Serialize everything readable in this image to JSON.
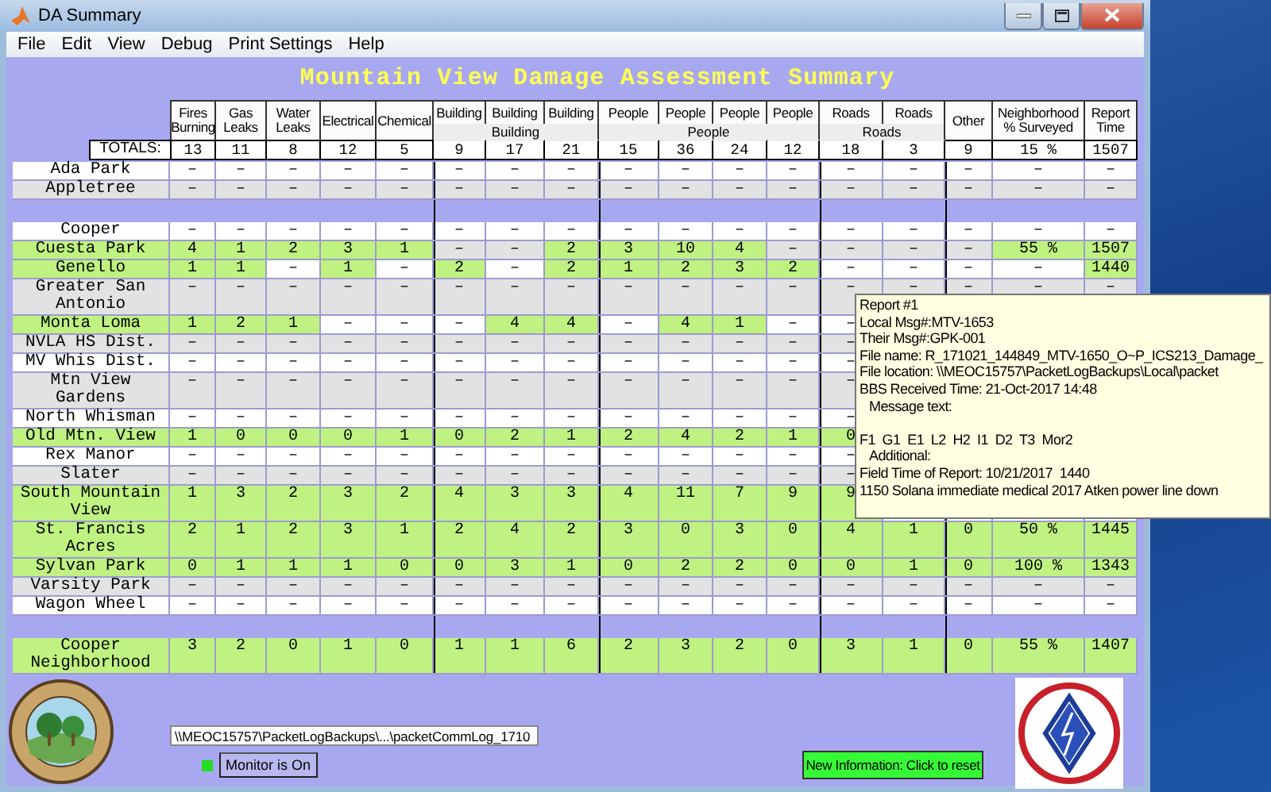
{
  "window": {
    "title": "DA Summary"
  },
  "menu": [
    "File",
    "Edit",
    "View",
    "Debug",
    "Print Settings",
    "Help"
  ],
  "heading": "Mountain View Damage Assessment Summary",
  "table": {
    "columns": [
      {
        "label": "Fires Burning"
      },
      {
        "label": "Gas Leaks"
      },
      {
        "label": "Water Leaks"
      },
      {
        "label": "Electrical"
      },
      {
        "label": "Chemical"
      },
      {
        "group": "Building",
        "columns": [
          {
            "label": "Building"
          },
          {
            "label": "Building"
          },
          {
            "label": "Building"
          }
        ]
      },
      {
        "group": "People",
        "columns": [
          {
            "label": "People"
          },
          {
            "label": "People"
          },
          {
            "label": "People"
          },
          {
            "label": "People"
          }
        ]
      },
      {
        "group": "Roads",
        "columns": [
          {
            "label": "Roads"
          },
          {
            "label": "Roads"
          }
        ]
      },
      {
        "label": "Other"
      },
      {
        "label": "Neighborhood % Surveyed"
      },
      {
        "label": "Report Time"
      }
    ],
    "totals": {
      "label": "TOTALS:",
      "values": [
        "13",
        "11",
        "8",
        "12",
        "5",
        "9",
        "17",
        "21",
        "15",
        "36",
        "24",
        "12",
        "18",
        "3",
        "9",
        "15 %",
        "1507"
      ]
    },
    "rows": [
      {
        "kind": "data",
        "name": "Ada Park",
        "highlighted": false,
        "cells": [
          {
            "text": "–",
            "highlighted": false
          },
          {
            "text": "–",
            "highlighted": false
          },
          {
            "text": "–",
            "highlighted": false
          },
          {
            "text": "–",
            "highlighted": false
          },
          {
            "text": "–",
            "highlighted": false
          },
          {
            "text": "–",
            "highlighted": false
          },
          {
            "text": "–",
            "highlighted": false
          },
          {
            "text": "–",
            "highlighted": false
          },
          {
            "text": "–",
            "highlighted": false
          },
          {
            "text": "–",
            "highlighted": false
          },
          {
            "text": "–",
            "highlighted": false
          },
          {
            "text": "–",
            "highlighted": false
          },
          {
            "text": "–",
            "highlighted": false
          },
          {
            "text": "–",
            "highlighted": false
          },
          {
            "text": "–",
            "highlighted": false
          },
          {
            "text": "–",
            "highlighted": false
          },
          {
            "text": "–",
            "highlighted": false
          }
        ]
      },
      {
        "kind": "data",
        "name": "Appletree",
        "highlighted": false,
        "cells": [
          {
            "text": "–",
            "highlighted": false
          },
          {
            "text": "–",
            "highlighted": false
          },
          {
            "text": "–",
            "highlighted": false
          },
          {
            "text": "–",
            "highlighted": false
          },
          {
            "text": "–",
            "highlighted": false
          },
          {
            "text": "–",
            "highlighted": false
          },
          {
            "text": "–",
            "highlighted": false
          },
          {
            "text": "–",
            "highlighted": false
          },
          {
            "text": "–",
            "highlighted": false
          },
          {
            "text": "–",
            "highlighted": false
          },
          {
            "text": "–",
            "highlighted": false
          },
          {
            "text": "–",
            "highlighted": false
          },
          {
            "text": "–",
            "highlighted": false
          },
          {
            "text": "–",
            "highlighted": false
          },
          {
            "text": "–",
            "highlighted": false
          },
          {
            "text": "–",
            "highlighted": false
          },
          {
            "text": "–",
            "highlighted": false
          }
        ]
      },
      {
        "kind": "separator"
      },
      {
        "kind": "data",
        "name": "Cooper",
        "highlighted": false,
        "cells": [
          {
            "text": "–",
            "highlighted": false
          },
          {
            "text": "–",
            "highlighted": false
          },
          {
            "text": "–",
            "highlighted": false
          },
          {
            "text": "–",
            "highlighted": false
          },
          {
            "text": "–",
            "highlighted": false
          },
          {
            "text": "–",
            "highlighted": false
          },
          {
            "text": "–",
            "highlighted": false
          },
          {
            "text": "–",
            "highlighted": false
          },
          {
            "text": "–",
            "highlighted": false
          },
          {
            "text": "–",
            "highlighted": false
          },
          {
            "text": "–",
            "highlighted": false
          },
          {
            "text": "–",
            "highlighted": false
          },
          {
            "text": "–",
            "highlighted": false
          },
          {
            "text": "–",
            "highlighted": false
          },
          {
            "text": "–",
            "highlighted": false
          },
          {
            "text": "–",
            "highlighted": false
          },
          {
            "text": "–",
            "highlighted": false
          }
        ]
      },
      {
        "kind": "data",
        "name": "Cuesta Park",
        "highlighted": true,
        "cells": [
          {
            "text": "4",
            "highlighted": true
          },
          {
            "text": "1",
            "highlighted": true
          },
          {
            "text": "2",
            "highlighted": true
          },
          {
            "text": "3",
            "highlighted": true
          },
          {
            "text": "1",
            "highlighted": true
          },
          {
            "text": "–",
            "highlighted": false
          },
          {
            "text": "–",
            "highlighted": false
          },
          {
            "text": "2",
            "highlighted": true
          },
          {
            "text": "3",
            "highlighted": true
          },
          {
            "text": "10",
            "highlighted": true
          },
          {
            "text": "4",
            "highlighted": true
          },
          {
            "text": "–",
            "highlighted": false
          },
          {
            "text": "–",
            "highlighted": false
          },
          {
            "text": "–",
            "highlighted": false
          },
          {
            "text": "–",
            "highlighted": false
          },
          {
            "text": "55 %",
            "highlighted": true
          },
          {
            "text": "1507",
            "highlighted": true
          }
        ]
      },
      {
        "kind": "data",
        "name": "Genello",
        "highlighted": true,
        "cells": [
          {
            "text": "1",
            "highlighted": true
          },
          {
            "text": "1",
            "highlighted": true
          },
          {
            "text": "–",
            "highlighted": false
          },
          {
            "text": "1",
            "highlighted": true
          },
          {
            "text": "–",
            "highlighted": false
          },
          {
            "text": "2",
            "highlighted": true
          },
          {
            "text": "–",
            "highlighted": false
          },
          {
            "text": "2",
            "highlighted": true
          },
          {
            "text": "1",
            "highlighted": true
          },
          {
            "text": "2",
            "highlighted": true
          },
          {
            "text": "3",
            "highlighted": true
          },
          {
            "text": "2",
            "highlighted": true
          },
          {
            "text": "–",
            "highlighted": false
          },
          {
            "text": "–",
            "highlighted": false
          },
          {
            "text": "–",
            "highlighted": false
          },
          {
            "text": "–",
            "highlighted": false
          },
          {
            "text": "1440",
            "highlighted": true
          }
        ]
      },
      {
        "kind": "data",
        "name": "Greater San Antonio",
        "highlighted": false,
        "cells": [
          {
            "text": "–",
            "highlighted": false
          },
          {
            "text": "–",
            "highlighted": false
          },
          {
            "text": "–",
            "highlighted": false
          },
          {
            "text": "–",
            "highlighted": false
          },
          {
            "text": "–",
            "highlighted": false
          },
          {
            "text": "–",
            "highlighted": false
          },
          {
            "text": "–",
            "highlighted": false
          },
          {
            "text": "–",
            "highlighted": false
          },
          {
            "text": "–",
            "highlighted": false
          },
          {
            "text": "–",
            "highlighted": false
          },
          {
            "text": "–",
            "highlighted": false
          },
          {
            "text": "–",
            "highlighted": false
          },
          {
            "text": "–",
            "highlighted": false
          },
          {
            "text": "–",
            "highlighted": false
          },
          {
            "text": "–",
            "highlighted": false
          },
          {
            "text": "–",
            "highlighted": false
          },
          {
            "text": "–",
            "highlighted": false
          }
        ]
      },
      {
        "kind": "data",
        "name": "Monta Loma",
        "highlighted": true,
        "cells": [
          {
            "text": "1",
            "highlighted": true
          },
          {
            "text": "2",
            "highlighted": true
          },
          {
            "text": "1",
            "highlighted": true
          },
          {
            "text": "–",
            "highlighted": false
          },
          {
            "text": "–",
            "highlighted": false
          },
          {
            "text": "–",
            "highlighted": false
          },
          {
            "text": "4",
            "highlighted": true
          },
          {
            "text": "4",
            "highlighted": true
          },
          {
            "text": "–",
            "highlighted": false
          },
          {
            "text": "4",
            "highlighted": true
          },
          {
            "text": "1",
            "highlighted": true
          },
          {
            "text": "–",
            "highlighted": false
          },
          {
            "text": "–",
            "highlighted": false
          }
        ]
      },
      {
        "kind": "data",
        "name": "NVLA HS Dist.",
        "highlighted": false,
        "cells": [
          {
            "text": "–",
            "highlighted": false
          },
          {
            "text": "–",
            "highlighted": false
          },
          {
            "text": "–",
            "highlighted": false
          },
          {
            "text": "–",
            "highlighted": false
          },
          {
            "text": "–",
            "highlighted": false
          },
          {
            "text": "–",
            "highlighted": false
          },
          {
            "text": "–",
            "highlighted": false
          },
          {
            "text": "–",
            "highlighted": false
          },
          {
            "text": "–",
            "highlighted": false
          },
          {
            "text": "–",
            "highlighted": false
          },
          {
            "text": "–",
            "highlighted": false
          },
          {
            "text": "–",
            "highlighted": false
          },
          {
            "text": "–",
            "highlighted": false
          }
        ]
      },
      {
        "kind": "data",
        "name": "MV Whis Dist.",
        "highlighted": false,
        "cells": [
          {
            "text": "–",
            "highlighted": false
          },
          {
            "text": "–",
            "highlighted": false
          },
          {
            "text": "–",
            "highlighted": false
          },
          {
            "text": "–",
            "highlighted": false
          },
          {
            "text": "–",
            "highlighted": false
          },
          {
            "text": "–",
            "highlighted": false
          },
          {
            "text": "–",
            "highlighted": false
          },
          {
            "text": "–",
            "highlighted": false
          },
          {
            "text": "–",
            "highlighted": false
          },
          {
            "text": "–",
            "highlighted": false
          },
          {
            "text": "–",
            "highlighted": false
          },
          {
            "text": "–",
            "highlighted": false
          },
          {
            "text": "–",
            "highlighted": false
          }
        ]
      },
      {
        "kind": "data",
        "name": "Mtn View Gardens",
        "highlighted": false,
        "cells": [
          {
            "text": "–",
            "highlighted": false
          },
          {
            "text": "–",
            "highlighted": false
          },
          {
            "text": "–",
            "highlighted": false
          },
          {
            "text": "–",
            "highlighted": false
          },
          {
            "text": "–",
            "highlighted": false
          },
          {
            "text": "–",
            "highlighted": false
          },
          {
            "text": "–",
            "highlighted": false
          },
          {
            "text": "–",
            "highlighted": false
          },
          {
            "text": "–",
            "highlighted": false
          },
          {
            "text": "–",
            "highlighted": false
          },
          {
            "text": "–",
            "highlighted": false
          },
          {
            "text": "–",
            "highlighted": false
          },
          {
            "text": "–",
            "highlighted": false
          }
        ]
      },
      {
        "kind": "data",
        "name": "North Whisman",
        "highlighted": false,
        "cells": [
          {
            "text": "–",
            "highlighted": false
          },
          {
            "text": "–",
            "highlighted": false
          },
          {
            "text": "–",
            "highlighted": false
          },
          {
            "text": "–",
            "highlighted": false
          },
          {
            "text": "–",
            "highlighted": false
          },
          {
            "text": "–",
            "highlighted": false
          },
          {
            "text": "–",
            "highlighted": false
          },
          {
            "text": "–",
            "highlighted": false
          },
          {
            "text": "–",
            "highlighted": false
          },
          {
            "text": "–",
            "highlighted": false
          },
          {
            "text": "–",
            "highlighted": false
          },
          {
            "text": "–",
            "highlighted": false
          },
          {
            "text": "–",
            "highlighted": false
          }
        ]
      },
      {
        "kind": "data",
        "name": "Old Mtn. View",
        "highlighted": true,
        "cells": [
          {
            "text": "1",
            "highlighted": true
          },
          {
            "text": "0",
            "highlighted": true
          },
          {
            "text": "0",
            "highlighted": true
          },
          {
            "text": "0",
            "highlighted": true
          },
          {
            "text": "1",
            "highlighted": true
          },
          {
            "text": "0",
            "highlighted": true
          },
          {
            "text": "2",
            "highlighted": true
          },
          {
            "text": "1",
            "highlighted": true
          },
          {
            "text": "2",
            "highlighted": true
          },
          {
            "text": "4",
            "highlighted": true
          },
          {
            "text": "2",
            "highlighted": true
          },
          {
            "text": "1",
            "highlighted": true
          },
          {
            "text": "0",
            "highlighted": true
          }
        ]
      },
      {
        "kind": "data",
        "name": "Rex Manor",
        "highlighted": false,
        "cells": [
          {
            "text": "–",
            "highlighted": false
          },
          {
            "text": "–",
            "highlighted": false
          },
          {
            "text": "–",
            "highlighted": false
          },
          {
            "text": "–",
            "highlighted": false
          },
          {
            "text": "–",
            "highlighted": false
          },
          {
            "text": "–",
            "highlighted": false
          },
          {
            "text": "–",
            "highlighted": false
          },
          {
            "text": "–",
            "highlighted": false
          },
          {
            "text": "–",
            "highlighted": false
          },
          {
            "text": "–",
            "highlighted": false
          },
          {
            "text": "–",
            "highlighted": false
          },
          {
            "text": "–",
            "highlighted": false
          },
          {
            "text": "–",
            "highlighted": false
          }
        ]
      },
      {
        "kind": "data",
        "name": "Slater",
        "highlighted": false,
        "cells": [
          {
            "text": "–",
            "highlighted": false
          },
          {
            "text": "–",
            "highlighted": false
          },
          {
            "text": "–",
            "highlighted": false
          },
          {
            "text": "–",
            "highlighted": false
          },
          {
            "text": "–",
            "highlighted": false
          },
          {
            "text": "–",
            "highlighted": false
          },
          {
            "text": "–",
            "highlighted": false
          },
          {
            "text": "–",
            "highlighted": false
          },
          {
            "text": "–",
            "highlighted": false
          },
          {
            "text": "–",
            "highlighted": false
          },
          {
            "text": "–",
            "highlighted": false
          },
          {
            "text": "–",
            "highlighted": false
          },
          {
            "text": "–",
            "highlighted": false
          }
        ]
      },
      {
        "kind": "data",
        "name": "South Mountain View",
        "highlighted": true,
        "cells": [
          {
            "text": "1",
            "highlighted": true
          },
          {
            "text": "3",
            "highlighted": true
          },
          {
            "text": "2",
            "highlighted": true
          },
          {
            "text": "3",
            "highlighted": true
          },
          {
            "text": "2",
            "highlighted": true
          },
          {
            "text": "4",
            "highlighted": true
          },
          {
            "text": "3",
            "highlighted": true
          },
          {
            "text": "3",
            "highlighted": true
          },
          {
            "text": "4",
            "highlighted": true
          },
          {
            "text": "11",
            "highlighted": true
          },
          {
            "text": "7",
            "highlighted": true
          },
          {
            "text": "9",
            "highlighted": true
          },
          {
            "text": "9",
            "highlighted": true
          }
        ]
      },
      {
        "kind": "data",
        "name": "St. Francis Acres",
        "highlighted": true,
        "cells": [
          {
            "text": "2",
            "highlighted": true
          },
          {
            "text": "1",
            "highlighted": true
          },
          {
            "text": "2",
            "highlighted": true
          },
          {
            "text": "3",
            "highlighted": true
          },
          {
            "text": "1",
            "highlighted": true
          },
          {
            "text": "2",
            "highlighted": true
          },
          {
            "text": "4",
            "highlighted": true
          },
          {
            "text": "2",
            "highlighted": true
          },
          {
            "text": "3",
            "highlighted": true
          },
          {
            "text": "0",
            "highlighted": true
          },
          {
            "text": "3",
            "highlighted": true
          },
          {
            "text": "0",
            "highlighted": true
          },
          {
            "text": "4",
            "highlighted": true
          },
          {
            "text": "1",
            "highlighted": true
          },
          {
            "text": "0",
            "highlighted": true
          },
          {
            "text": "50 %",
            "highlighted": true
          },
          {
            "text": "1445",
            "highlighted": true
          }
        ]
      },
      {
        "kind": "data",
        "name": "Sylvan Park",
        "highlighted": true,
        "cells": [
          {
            "text": "0",
            "highlighted": true
          },
          {
            "text": "1",
            "highlighted": true
          },
          {
            "text": "1",
            "highlighted": true
          },
          {
            "text": "1",
            "highlighted": true
          },
          {
            "text": "0",
            "highlighted": true
          },
          {
            "text": "0",
            "highlighted": true
          },
          {
            "text": "3",
            "highlighted": true
          },
          {
            "text": "1",
            "highlighted": true
          },
          {
            "text": "0",
            "highlighted": true
          },
          {
            "text": "2",
            "highlighted": true
          },
          {
            "text": "2",
            "highlighted": true
          },
          {
            "text": "0",
            "highlighted": true
          },
          {
            "text": "0",
            "highlighted": true
          },
          {
            "text": "1",
            "highlighted": true
          },
          {
            "text": "0",
            "highlighted": true
          },
          {
            "text": "100 %",
            "highlighted": true
          },
          {
            "text": "1343",
            "highlighted": true
          }
        ]
      },
      {
        "kind": "data",
        "name": "Varsity Park",
        "highlighted": false,
        "cells": [
          {
            "text": "–",
            "highlighted": false
          },
          {
            "text": "–",
            "highlighted": false
          },
          {
            "text": "–",
            "highlighted": false
          },
          {
            "text": "–",
            "highlighted": false
          },
          {
            "text": "–",
            "highlighted": false
          },
          {
            "text": "–",
            "highlighted": false
          },
          {
            "text": "–",
            "highlighted": false
          },
          {
            "text": "–",
            "highlighted": false
          },
          {
            "text": "–",
            "highlighted": false
          },
          {
            "text": "–",
            "highlighted": false
          },
          {
            "text": "–",
            "highlighted": false
          },
          {
            "text": "–",
            "highlighted": false
          },
          {
            "text": "–",
            "highlighted": false
          },
          {
            "text": "–",
            "highlighted": false
          },
          {
            "text": "–",
            "highlighted": false
          },
          {
            "text": "–",
            "highlighted": false
          },
          {
            "text": "–",
            "highlighted": false
          }
        ]
      },
      {
        "kind": "data",
        "name": "Wagon Wheel",
        "highlighted": false,
        "cells": [
          {
            "text": "–",
            "highlighted": false
          },
          {
            "text": "–",
            "highlighted": false
          },
          {
            "text": "–",
            "highlighted": false
          },
          {
            "text": "–",
            "highlighted": false
          },
          {
            "text": "–",
            "highlighted": false
          },
          {
            "text": "–",
            "highlighted": false
          },
          {
            "text": "–",
            "highlighted": false
          },
          {
            "text": "–",
            "highlighted": false
          },
          {
            "text": "–",
            "highlighted": false
          },
          {
            "text": "–",
            "highlighted": false
          },
          {
            "text": "–",
            "highlighted": false
          },
          {
            "text": "–",
            "highlighted": false
          },
          {
            "text": "–",
            "highlighted": false
          },
          {
            "text": "–",
            "highlighted": false
          },
          {
            "text": "–",
            "highlighted": false
          },
          {
            "text": "–",
            "highlighted": false
          },
          {
            "text": "–",
            "highlighted": false
          }
        ]
      },
      {
        "kind": "separator"
      },
      {
        "kind": "data",
        "name": "Cooper Neighborhood",
        "highlighted": true,
        "cells": [
          {
            "text": "3",
            "highlighted": true
          },
          {
            "text": "2",
            "highlighted": true
          },
          {
            "text": "0",
            "highlighted": true
          },
          {
            "text": "1",
            "highlighted": true
          },
          {
            "text": "0",
            "highlighted": true
          },
          {
            "text": "1",
            "highlighted": true
          },
          {
            "text": "1",
            "highlighted": true
          },
          {
            "text": "6",
            "highlighted": true
          },
          {
            "text": "2",
            "highlighted": true
          },
          {
            "text": "3",
            "highlighted": true
          },
          {
            "text": "2",
            "highlighted": true
          },
          {
            "text": "0",
            "highlighted": true
          },
          {
            "text": "3",
            "highlighted": true
          },
          {
            "text": "1",
            "highlighted": true
          },
          {
            "text": "0",
            "highlighted": true
          },
          {
            "text": "55 %",
            "highlighted": true
          },
          {
            "text": "1407",
            "highlighted": true
          }
        ]
      }
    ]
  },
  "tooltip": {
    "lines": [
      {
        "text": "Report #1"
      },
      {
        "text": "Local Msg#:MTV-1653"
      },
      {
        "text": "Their Msg#:GPK-001"
      },
      {
        "text": "File name: R_171021_144849_MTV-1650_O~P_ICS213_Damage_"
      },
      {
        "text": "File location: \\\\MEOC15757\\PacketLogBackups\\Local\\packet"
      },
      {
        "text": "BBS Received Time: 21-Oct-2017 14:48"
      },
      {
        "text": "Message text:",
        "indent": true,
        "gap_after": true
      },
      {
        "text": "F1  G1  E1  L2  H2  I1  D2  T3  Mor2"
      },
      {
        "text": "Additional:",
        "indent": true
      },
      {
        "text": "Field Time of Report: 10/21/2017  1440"
      },
      {
        "text": "1150 Solana immediate medical 2017 Atken power line down"
      }
    ]
  },
  "footer": {
    "log_path": "\\\\MEOC15757\\PacketLogBackups\\...\\packetCommLog_1710",
    "monitor": {
      "label": "Monitor is On",
      "on": true
    },
    "reset_button": "New Information: Click to reset"
  }
}
